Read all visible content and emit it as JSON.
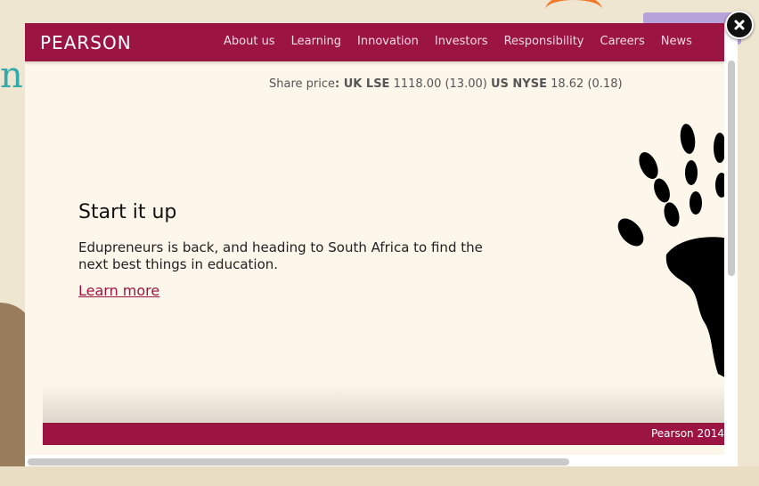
{
  "header": {
    "logo": "PEARSON",
    "nav": [
      "About us",
      "Learning",
      "Innovation",
      "Investors",
      "Responsibility",
      "Careers",
      "News"
    ]
  },
  "share_price": {
    "label": "Share price",
    "uk_exchange": "UK LSE",
    "uk_value": "1118.00 (13.00)",
    "us_exchange": "US NYSE",
    "us_value": "18.62 (0.18)"
  },
  "hero": {
    "title": "Start it up",
    "text": "Edupreneurs is back, and heading to South Africa to find the next best things in education.",
    "link": "Learn more"
  },
  "footer": {
    "copyright": "Pearson 2014"
  },
  "colors": {
    "brand": "#9c1542",
    "page_bg": "#fdf6ea"
  },
  "icons": {
    "close": "close-icon",
    "hand": "handprint-africa-graphic"
  }
}
